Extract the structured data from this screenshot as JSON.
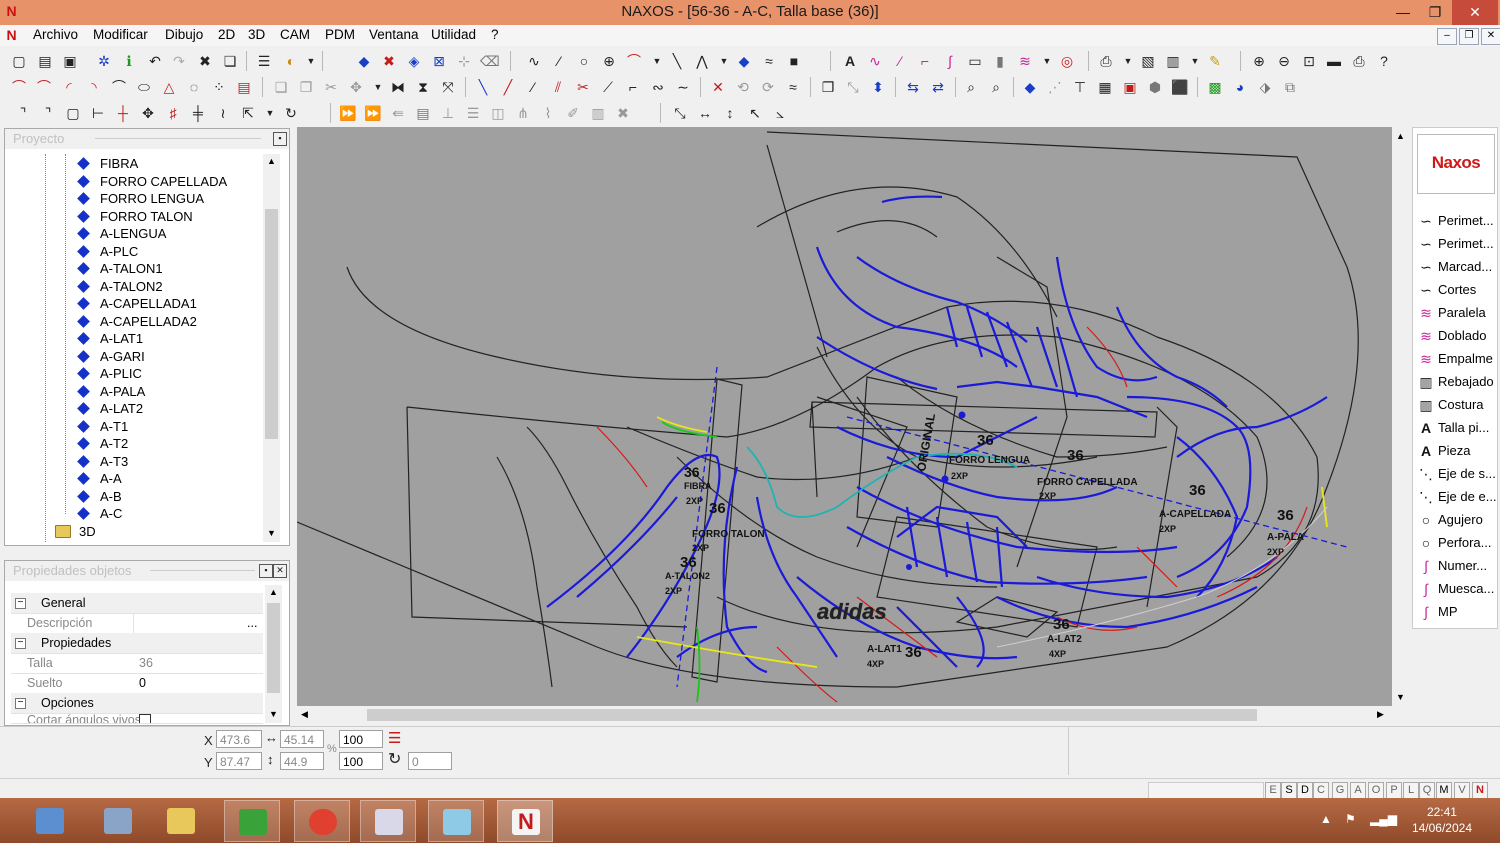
{
  "window": {
    "title": "NAXOS - [56-36 - A-C, Talla base (36)]",
    "minimize": "—",
    "maximize": "❐",
    "close": "✕"
  },
  "menu": [
    "Archivo",
    "Modificar",
    "Dibujo",
    "2D",
    "3D",
    "CAM",
    "PDM",
    "Ventana",
    "Utilidad",
    "?"
  ],
  "project": {
    "title": "Proyecto",
    "items": [
      "FIBRA",
      "FORRO CAPELLADA",
      "FORRO LENGUA",
      "FORRO TALON",
      "A-LENGUA",
      "A-PLC",
      "A-TALON1",
      "A-TALON2",
      "A-CAPELLADA1",
      "A-CAPELLADA2",
      "A-LAT1",
      "A-GARI",
      "A-PLIC",
      "A-PALA",
      "A-LAT2",
      "A-T1",
      "A-T2",
      "A-T3",
      "A-A",
      "A-B",
      "A-C"
    ],
    "folder": "3D"
  },
  "properties": {
    "title": "Propiedades objetos",
    "general": "General",
    "descripcion_label": "Descripción",
    "descripcion_btn": "...",
    "propiedades": "Propiedades",
    "talla_label": "Talla",
    "talla_value": "36",
    "suelto_label": "Suelto",
    "suelto_value": "0",
    "opciones": "Opciones",
    "cortar_label": "Cortar ángulos vivos"
  },
  "palette": {
    "logo": "Naxos",
    "items": [
      {
        "label": "Perimet...",
        "icon": "curve-icon"
      },
      {
        "label": "Perimet...",
        "icon": "curve-icon"
      },
      {
        "label": "Marcad...",
        "icon": "curve-icon"
      },
      {
        "label": "Cortes",
        "icon": "curve-icon"
      },
      {
        "label": "Paralela",
        "icon": "parallel-icon"
      },
      {
        "label": "Doblado",
        "icon": "fold-icon"
      },
      {
        "label": "Empalme",
        "icon": "join-icon"
      },
      {
        "label": "Rebajado",
        "icon": "skive-icon"
      },
      {
        "label": "Costura",
        "icon": "seam-icon"
      },
      {
        "label": "Talla pi...",
        "icon": "text-a-icon"
      },
      {
        "label": "Pieza",
        "icon": "text-a-icon"
      },
      {
        "label": "Eje de s...",
        "icon": "axis-icon"
      },
      {
        "label": "Eje de e...",
        "icon": "axis-icon"
      },
      {
        "label": "Agujero",
        "icon": "circle-icon"
      },
      {
        "label": "Perfora...",
        "icon": "circle-icon"
      },
      {
        "label": "Numer...",
        "icon": "number-icon"
      },
      {
        "label": "Muesca...",
        "icon": "notch-icon"
      },
      {
        "label": "MP",
        "icon": "mp-icon"
      }
    ]
  },
  "coords": {
    "x_label": "X",
    "y_label": "Y",
    "x": "473.6",
    "y": "87.47",
    "width": "45.14",
    "height": "44.9",
    "scale_x": "100",
    "scale_y": "100",
    "percent": "%",
    "angle": "0"
  },
  "statusbar": {
    "letters": [
      "E",
      "S",
      "D",
      "C",
      "G",
      "A",
      "O",
      "P",
      "L",
      "Q",
      "M",
      "V"
    ]
  },
  "drawing_labels": {
    "fibra_size": "36",
    "fibra_name": "FIBRA",
    "fibra_qty": "2XP",
    "forro_talon_size": "36",
    "forro_talon_name": "FORRO TALON",
    "forro_talon_qty": "2XP",
    "talon2_size": "36",
    "talon2_name": "A-TALON2",
    "talon2_qty": "2XP",
    "lat1_name": "A-LAT1",
    "lat1_qty": "4XP",
    "lat1_size": "36",
    "lat2_size": "36",
    "lat2_name": "A-LAT2",
    "lat2_qty": "4XP",
    "pala_size": "36",
    "pala_name": "A-PALA",
    "pala_qty": "2XP",
    "capellada_size": "36",
    "capellada_name": "A-CAPELLADA",
    "capellada_qty": "2XP",
    "forro_cap_size": "36",
    "forro_cap_name": "FORRO CAPELLADA",
    "forro_cap_qty": "2XP",
    "forro_lengua_size": "36",
    "forro_lengua_name": "FORRO LENGUA",
    "forro_lengua_qty": "2XP",
    "brand": "adidas",
    "rotated_text": "ORIGINAL"
  },
  "clock": {
    "time": "22:41",
    "date": "14/06/2024"
  },
  "colors": {
    "titlebar": "#e8926a",
    "taskbar": "#a0522d",
    "canvas": "#a0a0a0",
    "pattern_blue": "#1a1ad8",
    "pattern_dark": "#222222"
  }
}
